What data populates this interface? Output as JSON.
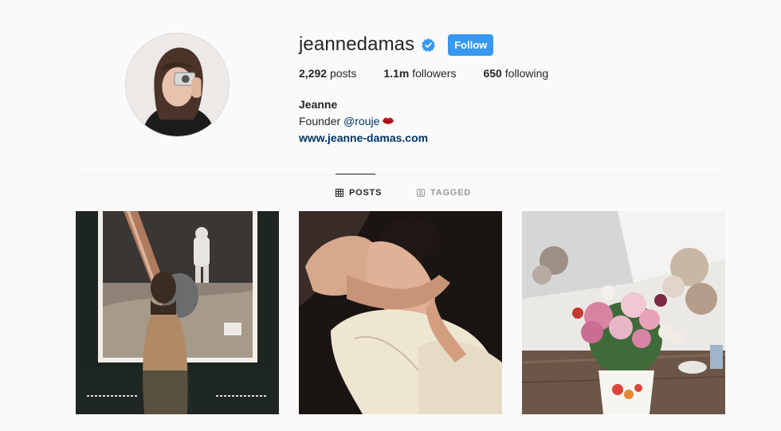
{
  "profile": {
    "username": "jeannedamas",
    "verified": true,
    "follow_label": "Follow",
    "stats": {
      "posts_count": "2,292",
      "posts_label": "posts",
      "followers_count": "1.1m",
      "followers_label": "followers",
      "following_count": "650",
      "following_label": "following"
    },
    "bio": {
      "name": "Jeanne",
      "line_prefix": "Founder ",
      "mention": "@rouje",
      "emoji": "lips-icon",
      "website": "www.jeanne-damas.com"
    }
  },
  "tabs": [
    {
      "label": "POSTS",
      "icon": "grid-icon",
      "active": true
    },
    {
      "label": "TAGGED",
      "icon": "tag-icon",
      "active": false
    }
  ],
  "colors": {
    "accent": "#3897f0",
    "link": "#003569",
    "background": "#fafafa",
    "divider": "#efefef",
    "text": "#262626",
    "muted": "#999999"
  }
}
